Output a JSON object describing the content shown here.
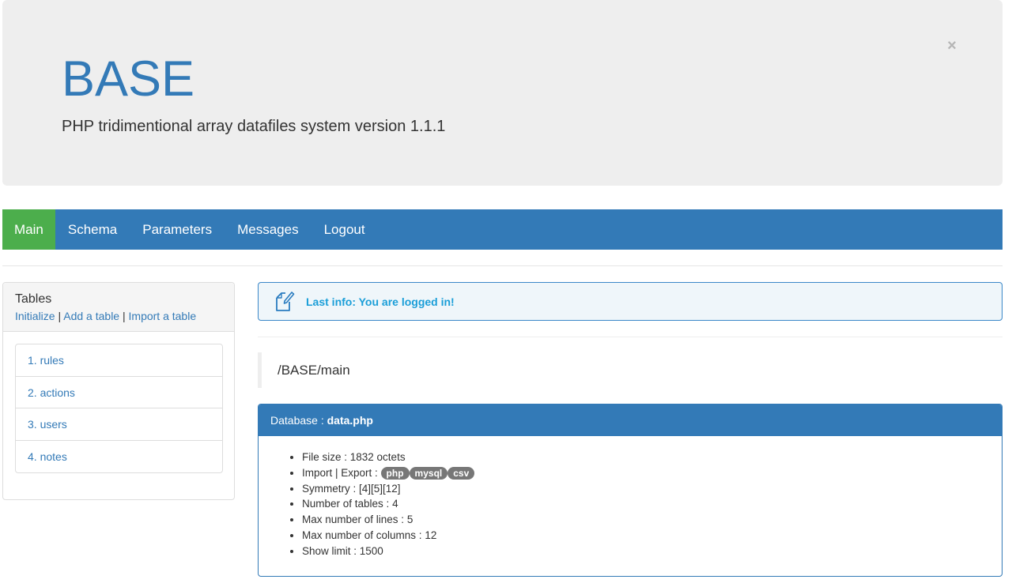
{
  "header": {
    "title": "BASE",
    "subtitle": "PHP tridimentional array datafiles system version 1.1.1",
    "close_symbol": "×"
  },
  "nav": {
    "items": [
      {
        "label": "Main",
        "active": true
      },
      {
        "label": "Schema",
        "active": false
      },
      {
        "label": "Parameters",
        "active": false
      },
      {
        "label": "Messages",
        "active": false
      },
      {
        "label": "Logout",
        "active": false
      }
    ],
    "active_color": "#4cae4c",
    "bar_color": "#337ab7"
  },
  "sidebar": {
    "title": "Tables",
    "links": {
      "initialize": "Initialize",
      "separator": " | ",
      "add": "Add a table",
      "import": "Import a table"
    },
    "tables": [
      {
        "label": "1. rules"
      },
      {
        "label": "2. actions"
      },
      {
        "label": "3. users"
      },
      {
        "label": "4. notes"
      }
    ]
  },
  "alert": {
    "icon": "edit-document-icon",
    "text": "Last info: You are logged in!"
  },
  "breadcrumb": {
    "path": "/BASE/main"
  },
  "database": {
    "label": "Database : ",
    "file": "data.php",
    "file_size_label": "File size : ",
    "file_size": "1832 octets",
    "import_export_label": "Import | Export : ",
    "formats": [
      "php",
      "mysql",
      "csv"
    ],
    "symmetry_label": "Symmetry : ",
    "symmetry": "[4][5][12]",
    "tables_label": "Number of tables : ",
    "tables": "4",
    "lines_label": "Max number of lines : ",
    "lines": "5",
    "columns_label": "Max number of columns : ",
    "columns": "12",
    "limit_label": "Show limit : ",
    "limit": "1500"
  }
}
